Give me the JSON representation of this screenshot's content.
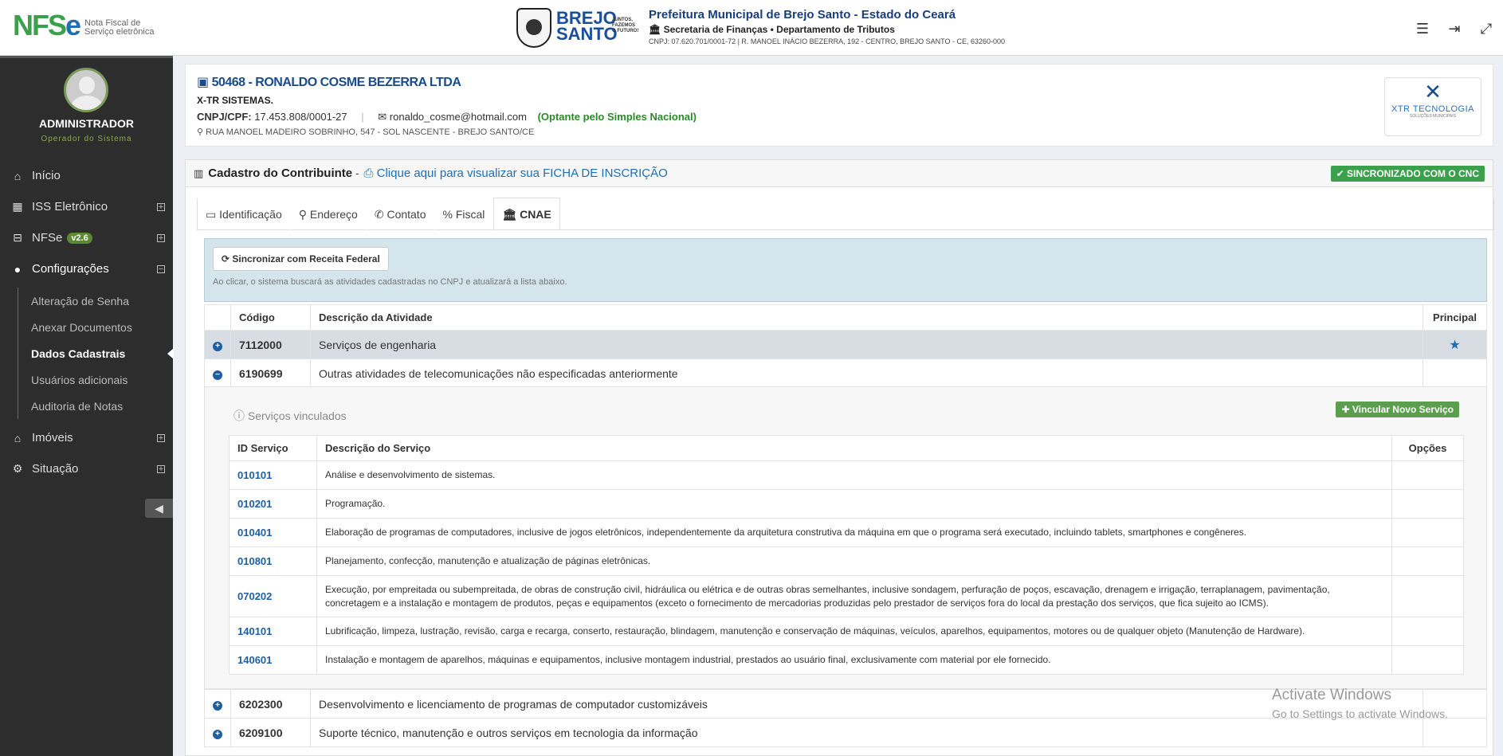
{
  "header": {
    "logo_main": "NFS",
    "logo_e": "e",
    "logo_sub": "Nota Fiscal de Serviço eletrônica",
    "brejo_line1": "BREJO",
    "brejo_line2": "SANTO",
    "brejo_slogan": "JUNTOS, FAZEMOS O FUTURO!",
    "pref_title": "Prefeitura Municipal de Brejo Santo - Estado do Ceará",
    "pref_sec": "Secretaria de Finanças • Departamento de Tributos",
    "pref_cnpj": "CNPJ: 07.620.701/0001-72 | R. MANOEL INÁCIO BEZERRA, 192 - CENTRO, BREJO SANTO - CE, 63260-000"
  },
  "sidebar": {
    "user_name": "ADMINISTRADOR",
    "user_role": "Operador do Sistema",
    "items": [
      {
        "label": "Início",
        "icon": "home-icon"
      },
      {
        "label": "ISS Eletrônico",
        "icon": "table-icon"
      },
      {
        "label": "NFSe",
        "badge": "v2.6",
        "icon": "inbox-icon"
      },
      {
        "label": "Configurações",
        "icon": "user-icon"
      },
      {
        "label": "Imóveis",
        "icon": "home-icon"
      },
      {
        "label": "Situação",
        "icon": "gear-icon"
      }
    ],
    "subitems": [
      "Alteração de Senha",
      "Anexar Documentos",
      "Dados Cadastrais",
      "Usuários adicionais",
      "Auditoria de Notas"
    ]
  },
  "company": {
    "title": "50468 - RONALDO COSME BEZERRA LTDA",
    "fantasia": "X-TR SISTEMAS.",
    "cnpj_label": "CNPJ/CPF:",
    "cnpj": "17.453.808/0001-27",
    "email": "ronaldo_cosme@hotmail.com",
    "simples": "(Optante pelo Simples Nacional)",
    "address": "RUA MANOEL MADEIRO SOBRINHO, 547 - SOL NASCENTE - BREJO SANTO/CE",
    "logo_text": "XTR TECNOLOGIA",
    "logo_sub": "SOLUÇÕES MUNICIPAIS"
  },
  "panel": {
    "title": "Cadastro do Contribuinte",
    "link": "Clique aqui para visualizar sua FICHA DE INSCRIÇÃO",
    "sync_status": "SINCRONIZADO COM O CNC",
    "tabs": [
      "Identificação",
      "Endereço",
      "Contato",
      "Fiscal",
      "CNAE"
    ],
    "sync_button": "Sincronizar com Receita Federal",
    "sync_hint": "Ao clicar, o sistema buscará as atividades cadastradas no CNPJ e atualizará a lista abaixo."
  },
  "cnae_table": {
    "headers": [
      "Código",
      "Descrição da Atividade",
      "Principal"
    ],
    "rows": [
      {
        "code": "7112000",
        "desc": "Serviços de engenharia"
      },
      {
        "code": "6190699",
        "desc": "Outras atividades de telecomunicações não especificadas anteriormente"
      }
    ],
    "rows_after": [
      {
        "code": "6202300",
        "desc": "Desenvolvimento e licenciamento de programas de computador customizáveis"
      },
      {
        "code": "6209100",
        "desc": "Suporte técnico, manutenção e outros serviços em tecnologia da informação"
      }
    ]
  },
  "services": {
    "title": "Serviços vinculados",
    "add_button": "Vincular Novo Serviço",
    "headers": [
      "ID Serviço",
      "Descrição do Serviço",
      "Opções"
    ],
    "rows": [
      {
        "id": "010101",
        "desc": "Análise e desenvolvimento de sistemas."
      },
      {
        "id": "010201",
        "desc": "Programação."
      },
      {
        "id": "010401",
        "desc": "Elaboração de programas de computadores, inclusive de jogos eletrônicos, independentemente da arquitetura construtiva da máquina em que o programa será executado, incluindo tablets, smartphones e congêneres."
      },
      {
        "id": "010801",
        "desc": "Planejamento, confecção, manutenção e atualização de páginas eletrônicas."
      },
      {
        "id": "070202",
        "desc": "Execução, por empreitada ou subempreitada, de obras de construção civil, hidráulica ou elétrica e de outras obras semelhantes, inclusive sondagem, perfuração de poços, escavação, drenagem e irrigação, terraplanagem, pavimentação, concretagem e a instalação e montagem de produtos, peças e equipamentos (exceto o fornecimento de mercadorias produzidas pelo prestador de serviços fora do local da prestação dos serviços, que fica sujeito ao ICMS)."
      },
      {
        "id": "140101",
        "desc": "Lubrificação, limpeza, lustração, revisão, carga e recarga, conserto, restauração, blindagem, manutenção e conservação de máquinas, veículos, aparelhos, equipamentos, motores ou de qualquer objeto (Manutenção de Hardware)."
      },
      {
        "id": "140601",
        "desc": "Instalação e montagem de aparelhos, máquinas e equipamentos, inclusive montagem industrial, prestados ao usuário final, exclusivamente com material por ele fornecido."
      }
    ]
  },
  "watermark": {
    "line1": "Activate Windows",
    "line2": "Go to Settings to activate Windows."
  }
}
